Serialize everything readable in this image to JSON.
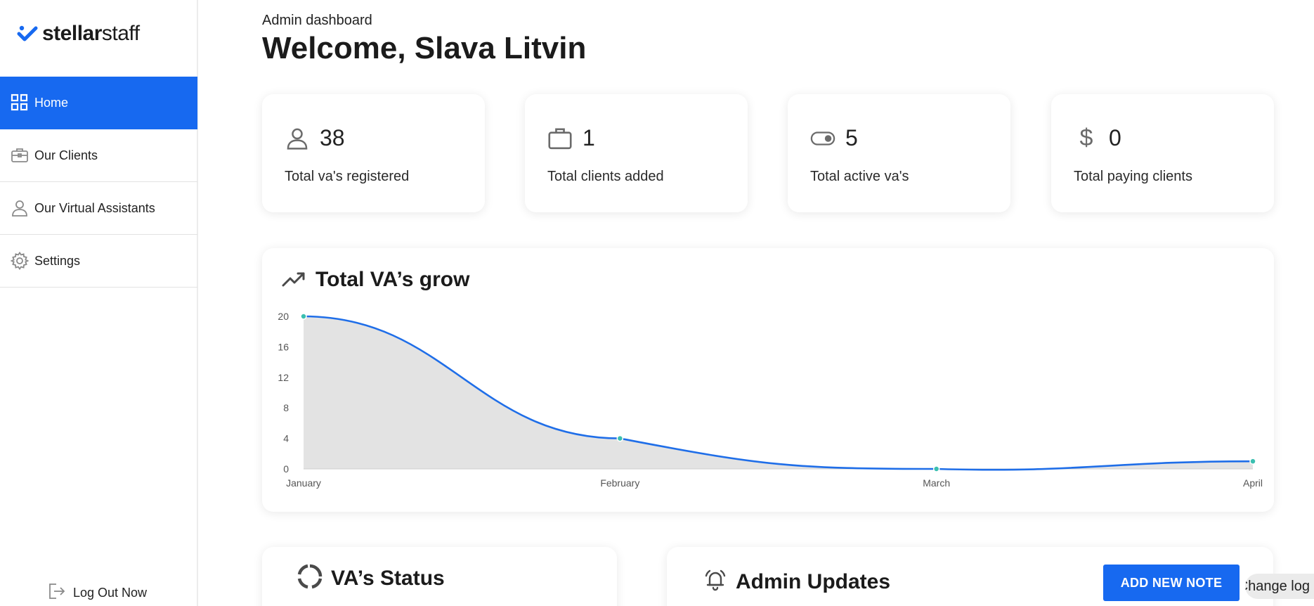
{
  "brand": {
    "name_bold": "stellar",
    "name_regular": "staff"
  },
  "sidebar": {
    "items": [
      {
        "label": "Home",
        "icon": "grid-icon",
        "active": true
      },
      {
        "label": "Our Clients",
        "icon": "briefcase-icon"
      },
      {
        "label": "Our Virtual Assistants",
        "icon": "person-icon"
      },
      {
        "label": "Settings",
        "icon": "gear-icon"
      }
    ],
    "logout": "Log Out Now"
  },
  "header": {
    "subtitle": "Admin dashboard",
    "title": "Welcome, Slava Litvin"
  },
  "stats": [
    {
      "value": "38",
      "label": "Total va's registered",
      "icon": "person-icon"
    },
    {
      "value": "1",
      "label": "Total clients added",
      "icon": "briefcase-icon"
    },
    {
      "value": "5",
      "label": "Total active va's",
      "icon": "toggle-icon"
    },
    {
      "value": "0",
      "label": "Total paying clients",
      "icon": "dollar-icon"
    }
  ],
  "growth_card": {
    "title": "Total VA’s grow",
    "icon": "trending-up-icon"
  },
  "chart_data": {
    "type": "area",
    "categories": [
      "January",
      "February",
      "March",
      "April"
    ],
    "values": [
      20,
      4,
      0,
      1
    ],
    "yticks": [
      0,
      4,
      8,
      12,
      16,
      20
    ],
    "ylim": [
      0,
      20
    ],
    "line_color": "#1f6ee8",
    "fill_color": "#e3e3e3",
    "point_color": "#3bbfb0",
    "grid": false
  },
  "status_card": {
    "title": "VA’s Status",
    "icon": "loading-circle-icon"
  },
  "updates_card": {
    "title": "Admin Updates",
    "icon": "bell-icon",
    "add_button": "ADD NEW NOTE"
  },
  "change_log": "Change log",
  "colors": {
    "accent": "#1769f0"
  }
}
